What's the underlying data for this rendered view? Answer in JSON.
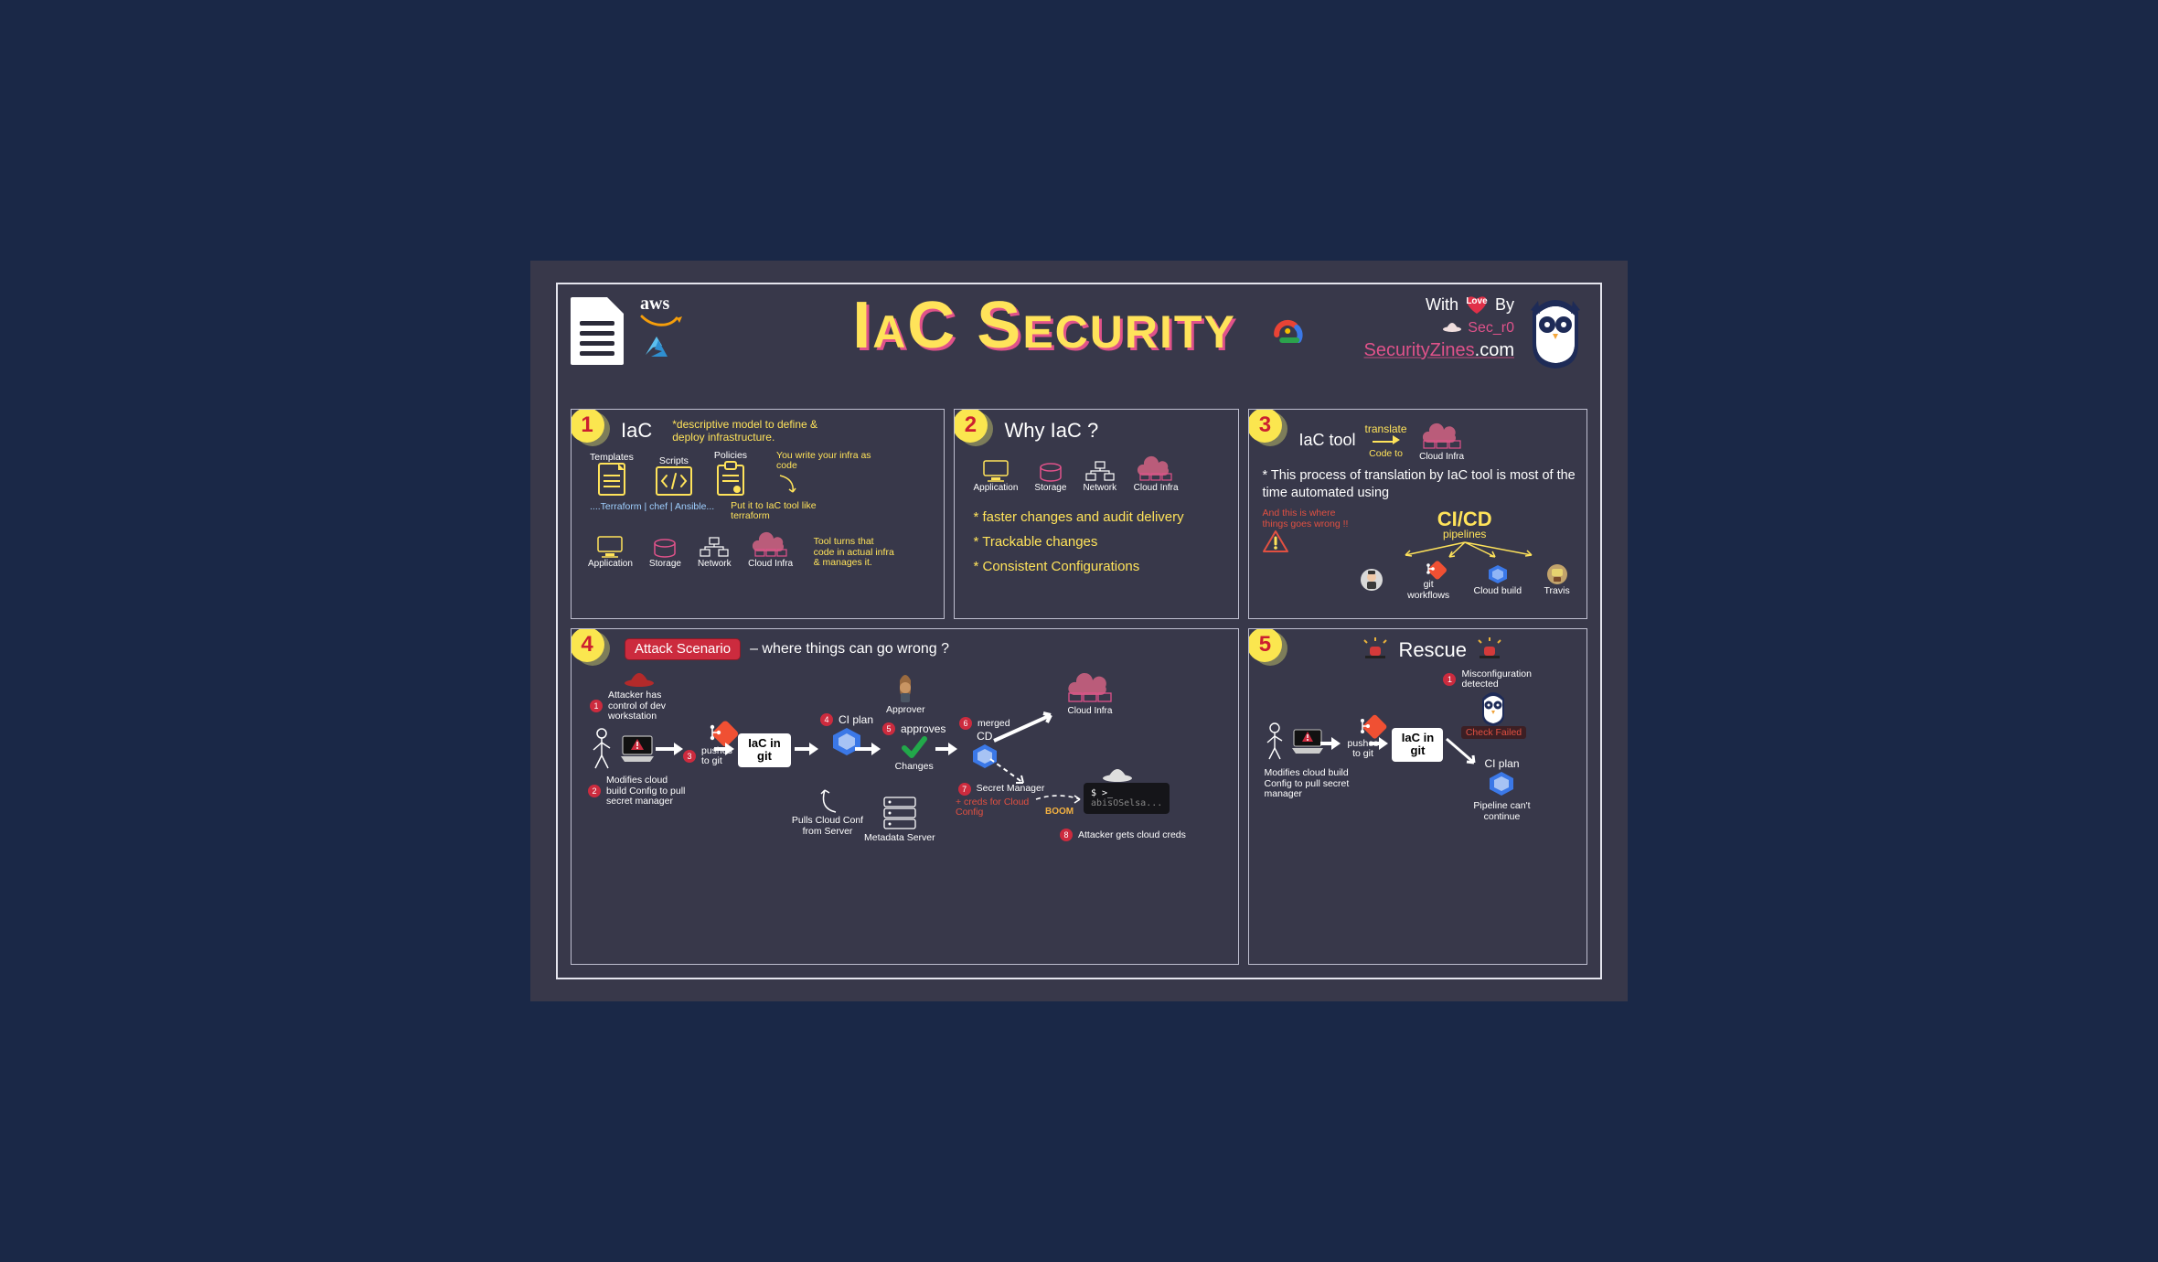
{
  "header": {
    "aws_text": "aws",
    "title": "IaC Security",
    "withlove_prefix": "With",
    "withlove_love": "Love",
    "withlove_suffix": "By",
    "sec_handle": "Sec_r0",
    "site_brand": "SecurityZines",
    "site_tld": ".com"
  },
  "panels": {
    "p1": {
      "num": "1",
      "title": "IaC",
      "subtitle": "*descriptive model to define & deploy infrastructure.",
      "artifacts": {
        "templates": "Templates",
        "scripts": "Scripts",
        "policies": "Policies"
      },
      "note_write": "You write your infra as code",
      "note_put": "Put it to IaC tool like terraform",
      "note_turns": "Tool turns that code in actual infra & manages it.",
      "tools": "....Terraform | chef | Ansible...",
      "infra": {
        "application": "Application",
        "storage": "Storage",
        "network": "Network",
        "cloud": "Cloud Infra"
      }
    },
    "p2": {
      "num": "2",
      "title": "Why IaC ?",
      "infra": {
        "application": "Application",
        "storage": "Storage",
        "network": "Network",
        "cloud": "Cloud Infra"
      },
      "bullets": [
        "* faster changes and audit delivery",
        "* Trackable changes",
        "* Consistent Configurations"
      ]
    },
    "p3": {
      "num": "3",
      "title_tool": "IaC tool",
      "translate": "translate",
      "code_to": "Code to",
      "cloud_label": "Cloud Infra",
      "line2": "* This process of translation by IaC tool is most of the time automated using",
      "cicd": "CI/CD",
      "pipelines": "pipelines",
      "warning": "And this is where things goes wrong !!",
      "cicd_items": {
        "git": "git workflows",
        "cloudbuild": "Cloud build",
        "travis": "Travis"
      }
    },
    "p4": {
      "num": "4",
      "title_badge": "Attack Scenario",
      "title_rest": "– where things can go wrong ?",
      "step1_num": "1",
      "step1": "Attacker has control of dev workstation",
      "step2_num": "2",
      "step2": "Modifies cloud build Config to pull secret manager",
      "step3_num": "3",
      "step3": "pushes to git",
      "iac_in_git": "IaC in git",
      "step4_num": "4",
      "step4": "CI plan",
      "pulls": "Pulls Cloud Conf from Server",
      "metadata": "Metadata Server",
      "approver": "Approver",
      "step5_num": "5",
      "step5": "approves",
      "changes": "Changes",
      "step6_num": "6",
      "merged": "merged",
      "cd_label": "CD",
      "cloud": "Cloud Infra",
      "step7_num": "7",
      "secret": "Secret Manager",
      "creds_plus": "+ creds for Cloud Config",
      "boom": "BOOM",
      "term_prompt": "$ >_",
      "term_body": "abisOSelsa...",
      "step8_num": "8",
      "step8": "Attacker gets cloud creds"
    },
    "p5": {
      "num": "5",
      "title": "Rescue",
      "pushes": "pushes to git",
      "iac_in_git": "IaC in git",
      "modifies": "Modifies cloud build Config to pull secret manager",
      "mis_num": "1",
      "mis": "Misconfiguration detected",
      "check_failed": "Check Failed",
      "ciplan": "CI plan",
      "cant": "Pipeline can't continue"
    }
  }
}
